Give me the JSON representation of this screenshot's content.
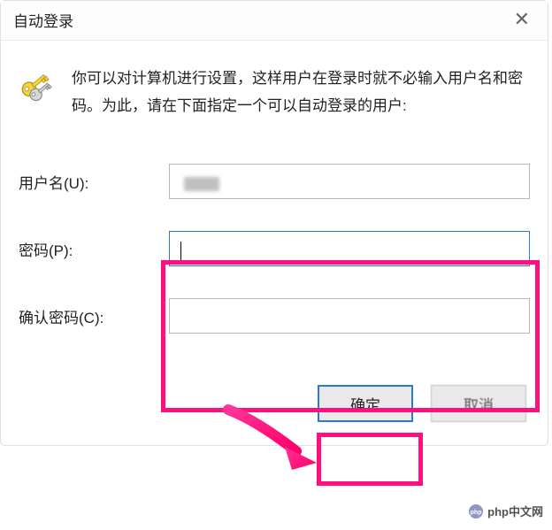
{
  "dialog": {
    "title": "自动登录",
    "description": "你可以对计算机进行设置，这样用户在登录时就不必输入用户名和密码。为此，请在下面指定一个可以自动登录的用户:"
  },
  "form": {
    "username_label": "用户名(U):",
    "username_value": "",
    "password_label": "密码(P):",
    "password_value": "",
    "confirm_label": "确认密码(C):",
    "confirm_value": ""
  },
  "buttons": {
    "ok": "确定",
    "cancel": "取消"
  },
  "watermark": {
    "text": "php中文网"
  }
}
